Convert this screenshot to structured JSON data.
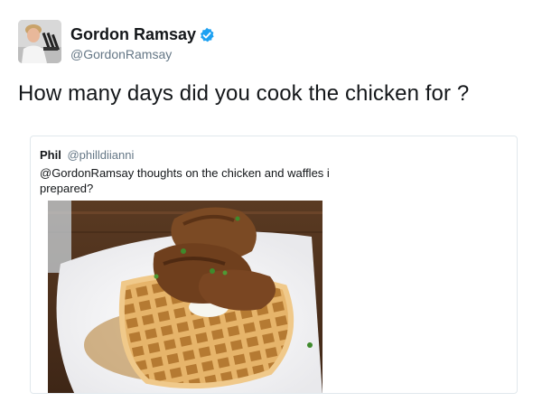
{
  "author": {
    "name": "Gordon Ramsay",
    "handle": "@GordonRamsay",
    "verified_color": "#1da1f2",
    "avatar_icon": "profile-photo"
  },
  "tweet": {
    "text": "How many days did you cook the chicken for ?"
  },
  "quoted_tweet": {
    "author_name": "Phil",
    "author_handle": "@philldiianni",
    "text_line1": "@GordonRamsay thoughts on the chicken and waffles i",
    "text_line2": "prepared?",
    "image": "chicken-and-waffles-photo"
  },
  "colors": {
    "text": "#14171a",
    "secondary": "#657786",
    "border": "#e1e8ed"
  }
}
